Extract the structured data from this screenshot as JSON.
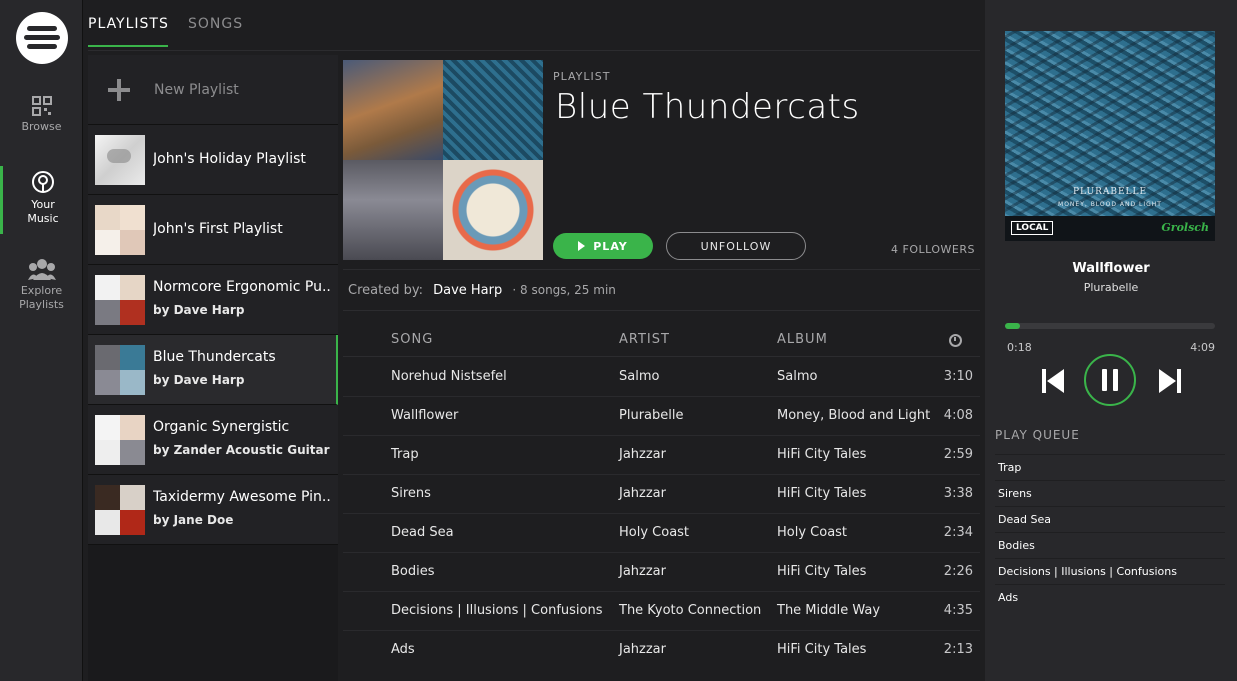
{
  "nav": {
    "browse": "Browse",
    "your_music_line1": "Your",
    "your_music_line2": "Music",
    "explore_line1": "Explore",
    "explore_line2": "Playlists"
  },
  "tabs": {
    "playlists": "PLAYLISTS",
    "songs": "SONGS"
  },
  "sidebar": {
    "new_playlist": "New Playlist",
    "playlists": [
      {
        "title": "John's Holiday Playlist",
        "owner": ""
      },
      {
        "title": "John's First Playlist",
        "owner": ""
      },
      {
        "title": "Normcore Ergonomic Pu..",
        "owner": "by Dave Harp"
      },
      {
        "title": "Blue Thundercats",
        "owner": "by Dave Harp"
      },
      {
        "title": "Organic Synergistic",
        "owner": "by Zander Acoustic Guitar"
      },
      {
        "title": "Taxidermy Awesome Pin..",
        "owner": "by Jane Doe"
      }
    ]
  },
  "playlist": {
    "label": "PLAYLIST",
    "title": "Blue Thundercats",
    "play_label": "PLAY",
    "unfollow_label": "UNFOLLOW",
    "followers": "4 FOLLOWERS",
    "created_by_label": "Created by:",
    "owner": "Dave Harp",
    "summary": "· 8 songs, 25 min"
  },
  "table": {
    "headers": {
      "song": "SONG",
      "artist": "ARTIST",
      "album": "ALBUM"
    },
    "rows": [
      {
        "song": "Norehud Nistsefel",
        "artist": "Salmo",
        "album": "Salmo",
        "duration": "3:10"
      },
      {
        "song": "Wallflower",
        "artist": "Plurabelle",
        "album": "Money, Blood and Light",
        "duration": "4:08"
      },
      {
        "song": "Trap",
        "artist": "Jahzzar",
        "album": "HiFi City Tales",
        "duration": "2:59"
      },
      {
        "song": "Sirens",
        "artist": "Jahzzar",
        "album": "HiFi City Tales",
        "duration": "3:38"
      },
      {
        "song": "Dead Sea",
        "artist": "Holy Coast",
        "album": "Holy Coast",
        "duration": "2:34"
      },
      {
        "song": "Bodies",
        "artist": "Jahzzar",
        "album": "HiFi City Tales",
        "duration": "2:26"
      },
      {
        "song": "Decisions | Illusions | Confusions",
        "artist": "The Kyoto Connection",
        "album": "The Middle Way",
        "duration": "4:35"
      },
      {
        "song": "Ads",
        "artist": "Jahzzar",
        "album": "HiFi City Tales",
        "duration": "2:13"
      }
    ]
  },
  "now_playing": {
    "title": "Wallflower",
    "artist": "Plurabelle",
    "elapsed": "0:18",
    "total": "4:09",
    "progress_fraction": 0.072,
    "art_text": "PLURABELLE",
    "art_subtext": "MONEY, BLOOD AND LIGHT",
    "art_logo": "LOCAL",
    "art_brand": "Grolsch"
  },
  "queue": {
    "label": "PLAY QUEUE",
    "items": [
      "Trap",
      "Sirens",
      "Dead Sea",
      "Bodies",
      "Decisions | Illusions | Confusions",
      "Ads"
    ]
  },
  "colors": {
    "accent": "#3ab44a",
    "background": "#1e1e20",
    "panel": "#28282b"
  }
}
